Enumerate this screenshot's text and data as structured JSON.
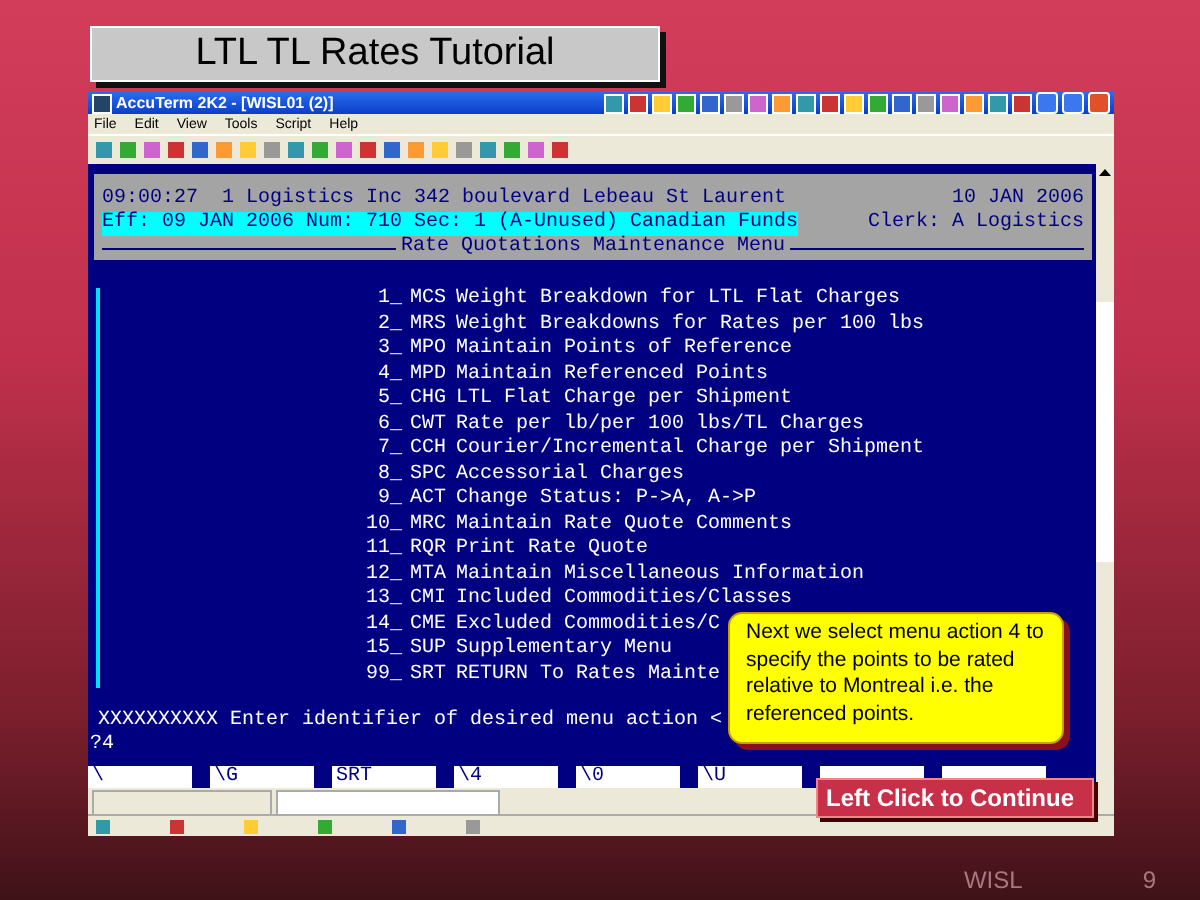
{
  "slide_title": "LTL TL Rates Tutorial",
  "window": {
    "title": "AccuTerm 2K2 - [WISL01 (2)]"
  },
  "menu": [
    "File",
    "Edit",
    "View",
    "Tools",
    "Script",
    "Help"
  ],
  "terminal": {
    "header": {
      "time": "09:00:27",
      "company": "1 Logistics Inc 342 boulevard Lebeau St Laurent",
      "date": "10 JAN 2006",
      "status": "Eff: 09 JAN 2006 Num: 710 Sec: 1 (A-Unused) Canadian Funds",
      "clerk": "Clerk: A Logistics"
    },
    "menu_title": "Rate Quotations Maintenance Menu",
    "items": [
      {
        "number": "1_",
        "code": "MCS",
        "description": "Weight Breakdown for LTL Flat Charges"
      },
      {
        "number": "2_",
        "code": "MRS",
        "description": "Weight Breakdowns for Rates per 100 lbs"
      },
      {
        "number": "3_",
        "code": "MPO",
        "description": "Maintain Points of Reference"
      },
      {
        "number": "4_",
        "code": "MPD",
        "description": "Maintain Referenced Points"
      },
      {
        "number": "5_",
        "code": "CHG",
        "description": "LTL Flat Charge per Shipment"
      },
      {
        "number": "6_",
        "code": "CWT",
        "description": "Rate per lb/per 100 lbs/TL Charges"
      },
      {
        "number": "7_",
        "code": "CCH",
        "description": "Courier/Incremental Charge per Shipment"
      },
      {
        "number": "8_",
        "code": "SPC",
        "description": "Accessorial Charges"
      },
      {
        "number": "9_",
        "code": "ACT",
        "description": "Change Status: P->A, A->P"
      },
      {
        "number": "10_",
        "code": "MRC",
        "description": "Maintain Rate Quote Comments"
      },
      {
        "number": "11_",
        "code": "RQR",
        "description": "Print Rate Quote"
      },
      {
        "number": "12_",
        "code": "MTA",
        "description": "Maintain Miscellaneous Information"
      },
      {
        "number": "13_",
        "code": "CMI",
        "description": "Included Commodities/Classes"
      },
      {
        "number": "14_",
        "code": "CME",
        "description": "Excluded Commodities/C"
      },
      {
        "number": "15_",
        "code": "SUP",
        "description": "Supplementary Menu"
      },
      {
        "number": "99_",
        "code": "SRT",
        "description": "RETURN To Rates Mainte"
      }
    ],
    "prompt": "XXXXXXXXXX Enter identifier of desired menu action <",
    "input": "?4"
  },
  "function_keys": [
    "\\",
    "\\G",
    "SRT",
    "\\4",
    "\\0",
    "\\U"
  ],
  "callout": "Next we select menu action 4 to specify the points to be rated relative to Montreal i.e. the referenced points.",
  "continue_button": "Left Click to Continue",
  "footer": {
    "label": "WISL",
    "page": "9"
  }
}
